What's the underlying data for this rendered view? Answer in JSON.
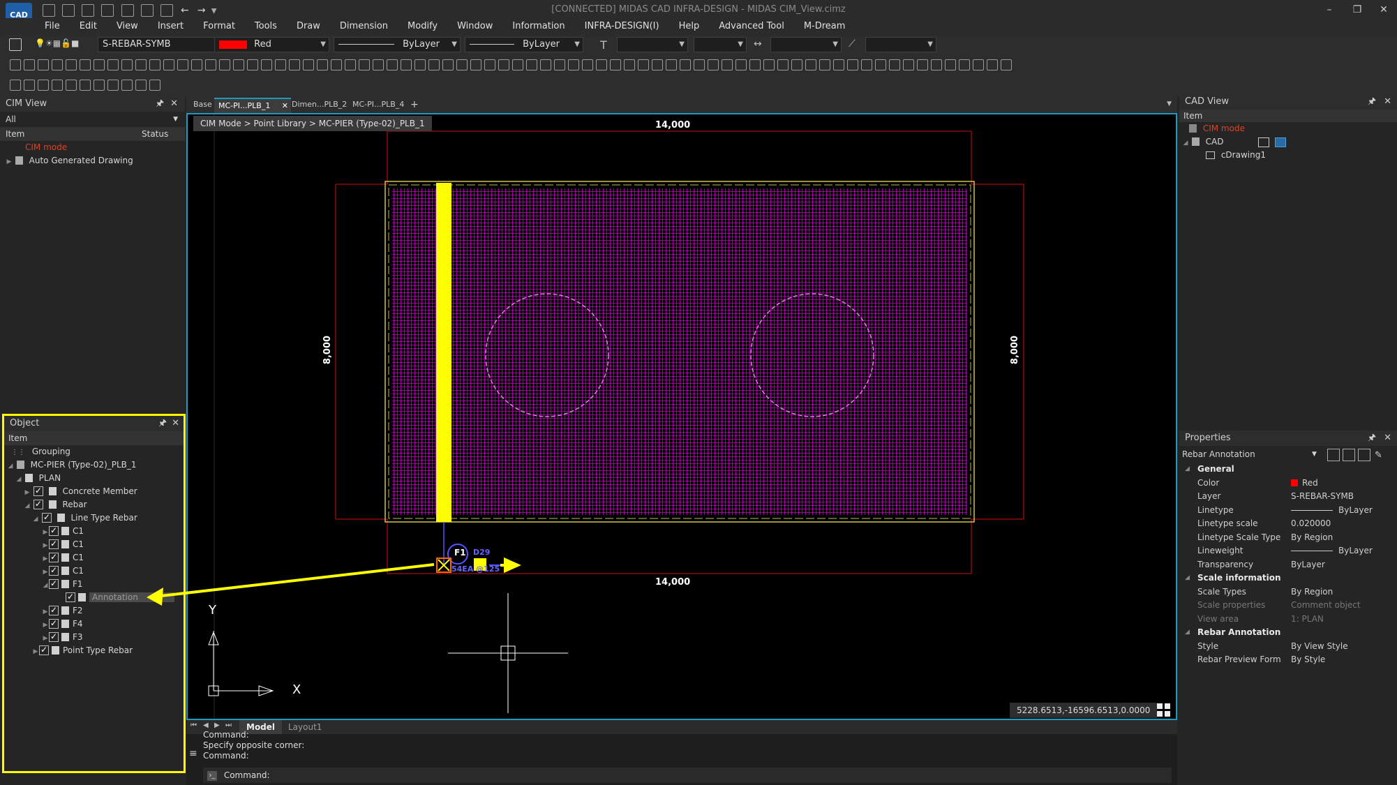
{
  "window": {
    "logo_label": "CAD",
    "title": "[CONNECTED] MIDAS CAD INFRA-DESIGN - MIDAS CIM_View.cimz",
    "minimize": "–",
    "restore": "❐",
    "close": "✕"
  },
  "menu": [
    "File",
    "Edit",
    "View",
    "Insert",
    "Format",
    "Tools",
    "Draw",
    "Dimension",
    "Modify",
    "Window",
    "Information",
    "INFRA-DESIGN(I)",
    "Help",
    "Advanced Tool",
    "M-Dream"
  ],
  "props_toolbar": {
    "layer_value": "S-REBAR-SYMB",
    "color_value": "Red",
    "color_swatch": "#ff0000",
    "linetype_value": "ByLayer",
    "lineweight_value": "ByLayer"
  },
  "cim_view": {
    "title": "CIM View",
    "filter": "All",
    "col_item": "Item",
    "col_status": "Status",
    "items": [
      "CIM mode",
      "Auto Generated Drawing"
    ]
  },
  "object_panel": {
    "title": "Object",
    "col_item": "Item",
    "items": {
      "grouping": "Grouping",
      "root": "MC-PIER (Type-02)_PLB_1",
      "plan": "PLAN",
      "concrete": "Concrete Member",
      "rebar": "Rebar",
      "line_type": "Line Type Rebar",
      "c1a": "C1",
      "c1b": "C1",
      "c1c": "C1",
      "c1d": "C1",
      "f1": "F1",
      "annotation": "Annotation",
      "f2": "F2",
      "f4": "F4",
      "f3": "F3",
      "point_type": "Point Type Rebar"
    }
  },
  "doc_tabs": [
    "Base",
    "MC-PI...PLB_1",
    "Dimen...PLB_2",
    "MC-PI...PLB_4"
  ],
  "doc_tab_close": "✕",
  "doc_tab_add": "+",
  "breadcrumb": "CIM Mode > Point Library > MC-PIER (Type-02)_PLB_1",
  "drawing": {
    "dim_top": "14,000",
    "dim_bottom": "14,000",
    "dim_left": "8,000",
    "dim_right": "8,000",
    "rebar_label_mark": "F1",
    "rebar_label_size": "D29",
    "rebar_label_count": "54EA @125",
    "ucs_y": "Y",
    "ucs_x": "X",
    "hatch_color": "#c800c8",
    "rebar_color": "#ffff00"
  },
  "coords": "5228.6513,-16596.6513,0.0000",
  "layout_tabs": [
    "Model",
    "Layout1"
  ],
  "command": {
    "history": [
      "Command:",
      "Specify opposite corner:",
      "Command:"
    ],
    "prompt": "Command:"
  },
  "cad_view": {
    "title": "CAD View",
    "col_item": "Item",
    "items": [
      "CIM mode",
      "CAD",
      "cDrawing1"
    ]
  },
  "properties": {
    "title": "Properties",
    "selection": "Rebar Annotation",
    "sections": {
      "general": "General",
      "scale": "Scale information",
      "rebar": "Rebar Annotation"
    },
    "rows": [
      {
        "k": "Color",
        "v": "Red"
      },
      {
        "k": "Layer",
        "v": "S-REBAR-SYMB"
      },
      {
        "k": "Linetype",
        "v": "ByLayer"
      },
      {
        "k": "Linetype scale",
        "v": "0.020000"
      },
      {
        "k": "Linetype Scale Type",
        "v": "By Region"
      },
      {
        "k": "Lineweight",
        "v": "ByLayer"
      },
      {
        "k": "Transparency",
        "v": "ByLayer"
      },
      {
        "k": "Scale Types",
        "v": "By Region"
      },
      {
        "k": "Scale properties",
        "v": "Comment object"
      },
      {
        "k": "View area",
        "v": "1: PLAN"
      },
      {
        "k": "Style",
        "v": "By View Style"
      },
      {
        "k": "Rebar Preview Form",
        "v": "By Style"
      }
    ]
  }
}
